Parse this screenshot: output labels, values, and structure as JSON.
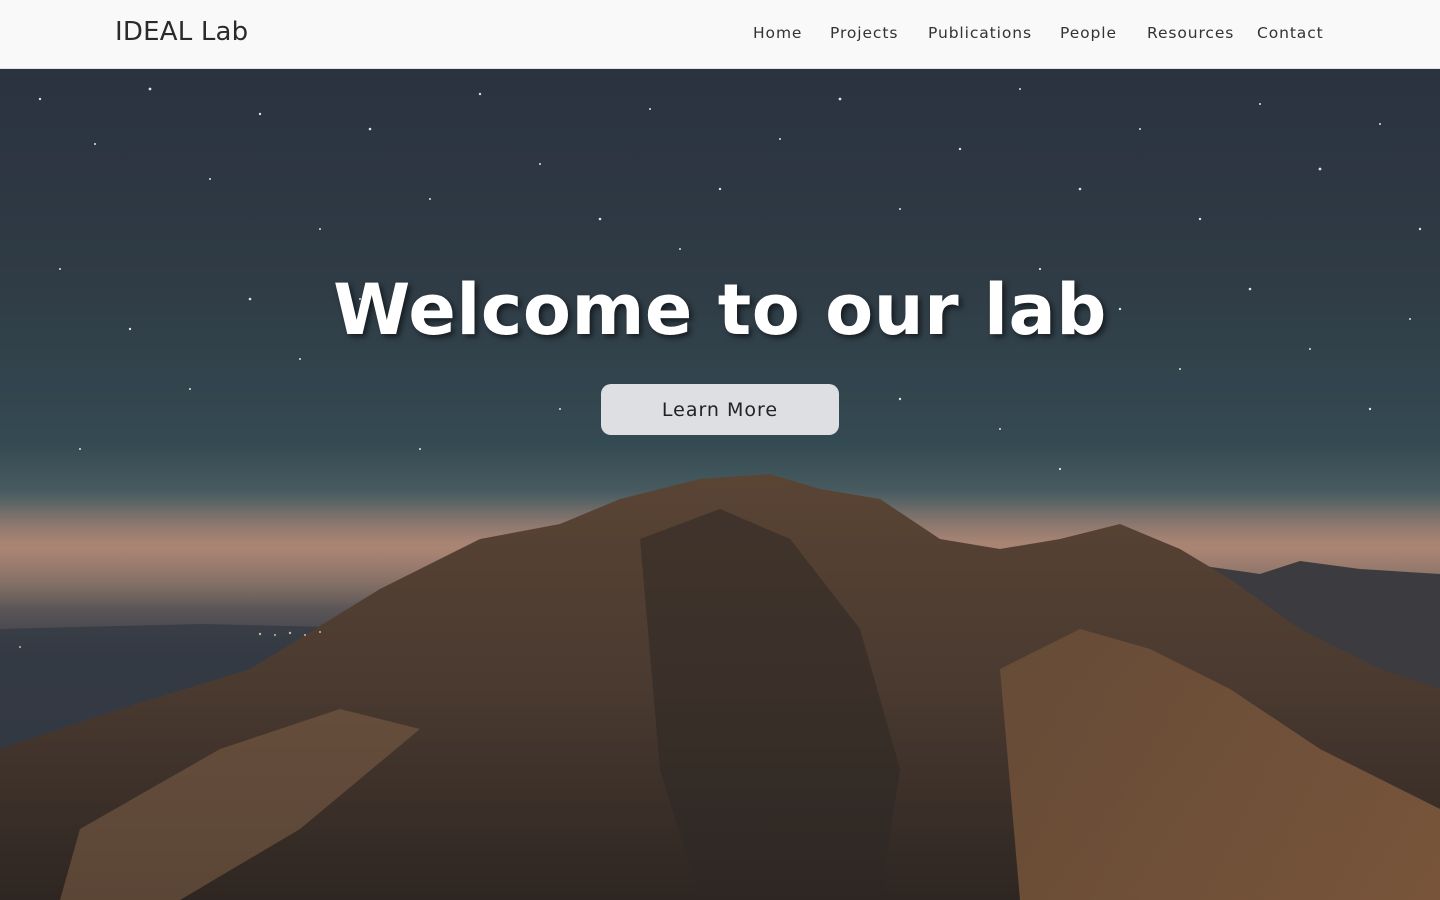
{
  "navbar": {
    "brand": "IDEAL Lab",
    "links": [
      {
        "label": "Home"
      },
      {
        "label": "Projects"
      },
      {
        "label": "Publications"
      },
      {
        "label": "People"
      },
      {
        "label": "Resources"
      },
      {
        "label": "Contact"
      }
    ]
  },
  "hero": {
    "title": "Welcome to our lab",
    "button_label": "Learn More"
  },
  "colors": {
    "navbar_background": "#f9f9f9",
    "hero_title": "#ffffff",
    "button_background": "#e8e8ea"
  }
}
